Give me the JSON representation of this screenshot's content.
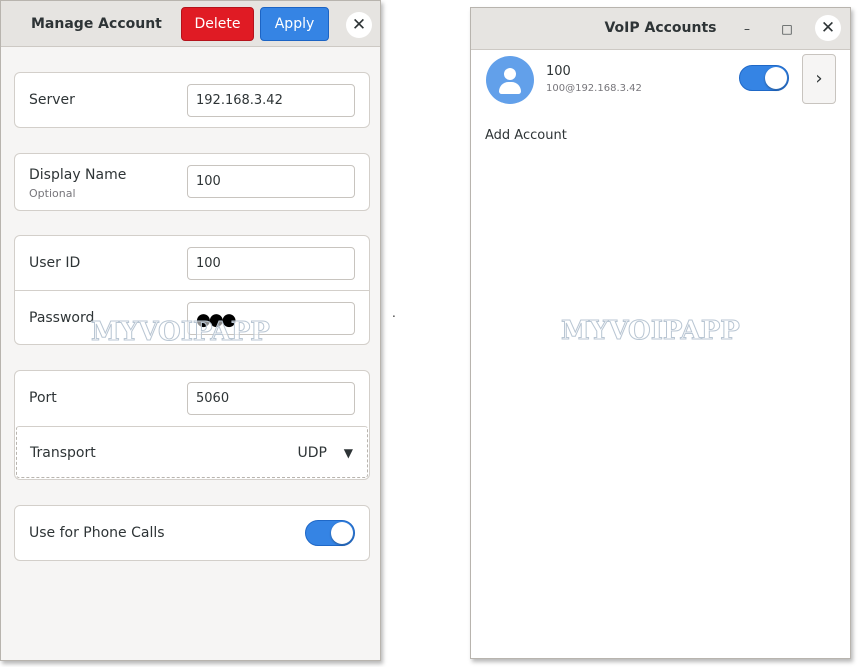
{
  "manage_account": {
    "title": "Manage Account",
    "delete_label": "Delete",
    "apply_label": "Apply",
    "close_glyph": "✕",
    "server": {
      "label": "Server",
      "value": "192.168.3.42"
    },
    "display_name": {
      "label": "Display Name",
      "sublabel": "Optional",
      "value": "100"
    },
    "user_id": {
      "label": "User ID",
      "value": "100"
    },
    "password": {
      "label": "Password",
      "dots": "●●●"
    },
    "port": {
      "label": "Port",
      "value": "5060"
    },
    "transport": {
      "label": "Transport",
      "value": "UDP",
      "arrow": "▼"
    },
    "phone_calls": {
      "label": "Use for Phone Calls",
      "enabled": true
    },
    "watermark": "MYVOIPAPP"
  },
  "separator": ".",
  "voip_accounts": {
    "title": "VoIP Accounts",
    "minimize_glyph": "–",
    "maximize_glyph": "□",
    "close_glyph": "✕",
    "accounts": [
      {
        "name": "100",
        "address": "100@192.168.3.42",
        "enabled": true,
        "detail_glyph": "›"
      }
    ],
    "add_account_label": "Add Account",
    "watermark": "MYVOIPAPP"
  },
  "colors": {
    "accent": "#3584e4",
    "destructive": "#e01b24",
    "avatar": "#62a0ea"
  },
  "icons": [
    "close-icon",
    "minimize-icon",
    "maximize-icon",
    "chevron-right-icon",
    "dropdown-arrow-icon",
    "user-avatar-icon"
  ]
}
